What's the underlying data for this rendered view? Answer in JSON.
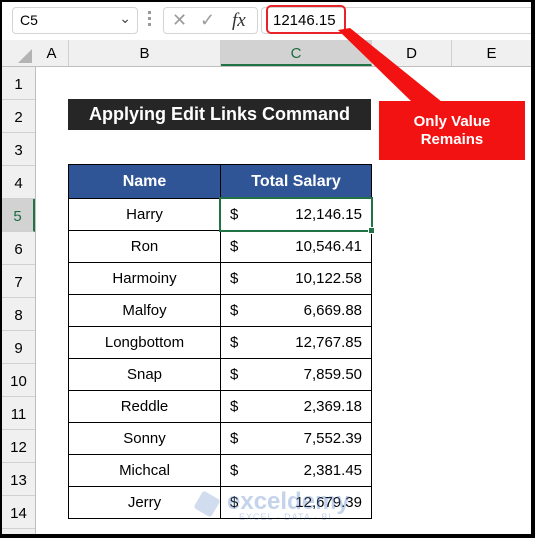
{
  "formula_bar": {
    "name_box": "C5",
    "cancel_icon": "✕",
    "enter_icon": "✓",
    "fx_label": "fx",
    "formula_value": "12146.15"
  },
  "columns": [
    "A",
    "B",
    "C",
    "D",
    "E"
  ],
  "selected_column": "C",
  "rows": [
    "1",
    "2",
    "3",
    "4",
    "5",
    "6",
    "7",
    "8",
    "9",
    "10",
    "11",
    "12",
    "13",
    "14"
  ],
  "selected_row": "5",
  "title": "Applying Edit Links Command",
  "table": {
    "headers": [
      "Name",
      "Total Salary"
    ],
    "rows": [
      {
        "name": "Harry",
        "currency": "$",
        "salary": "12,146.15"
      },
      {
        "name": "Ron",
        "currency": "$",
        "salary": "10,546.41"
      },
      {
        "name": "Harmoiny",
        "currency": "$",
        "salary": "10,122.58"
      },
      {
        "name": "Malfoy",
        "currency": "$",
        "salary": "6,669.88"
      },
      {
        "name": "Longbottom",
        "currency": "$",
        "salary": "12,767.85"
      },
      {
        "name": "Snap",
        "currency": "$",
        "salary": "7,859.50"
      },
      {
        "name": "Reddle",
        "currency": "$",
        "salary": "2,369.18"
      },
      {
        "name": "Sonny",
        "currency": "$",
        "salary": "7,552.39"
      },
      {
        "name": "Michcal",
        "currency": "$",
        "salary": "2,381.45"
      },
      {
        "name": "Jerry",
        "currency": "$",
        "salary": "12,679.39"
      }
    ]
  },
  "callout": {
    "line1": "Only Value",
    "line2": "Remains",
    "color": "#f21212"
  },
  "watermark": {
    "brand": "exceldemy",
    "tagline": "EXCEL · DATA · BI"
  },
  "colors": {
    "header_fill": "#2f5597",
    "title_fill": "#262626",
    "selection": "#217346"
  }
}
